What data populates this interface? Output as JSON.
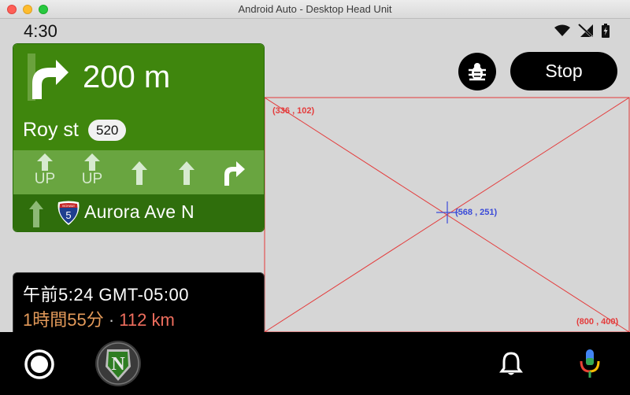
{
  "window": {
    "title": "Android Auto - Desktop Head Unit"
  },
  "status_bar": {
    "time": "4:30",
    "icons": [
      "wifi-icon",
      "no-signal-icon",
      "battery-icon"
    ]
  },
  "navigation": {
    "maneuver_icon": "turn-right-icon",
    "distance": "200 m",
    "street": "Roy st",
    "route_number": "520",
    "lanes": [
      {
        "icon": "lane-straight-icon",
        "label": "UP"
      },
      {
        "icon": "lane-straight-icon",
        "label": "UP"
      },
      {
        "icon": "lane-straight-icon",
        "label": ""
      },
      {
        "icon": "lane-straight-icon",
        "label": ""
      },
      {
        "icon": "lane-turn-right-icon",
        "label": ""
      }
    ],
    "then": {
      "icon": "straight-arrow-icon",
      "shield_label": "HIGHWAY",
      "shield_number": "5",
      "road": "Aurora Ave N"
    }
  },
  "eta": {
    "arrival": "午前5:24 GMT-05:00",
    "duration": "1時間55分",
    "separator": "·",
    "distance": "112 km"
  },
  "controls": {
    "debug_icon": "bug-icon",
    "stop_label": "Stop"
  },
  "map_debug": {
    "top_left_label": "(336 , 102)",
    "center_label": "(568 , 251)",
    "bottom_right_label": "(800 , 400)",
    "line_color": "#e43b3b",
    "center_color": "#3b4bd8"
  },
  "bottom_bar": {
    "home_icon": "home-icon",
    "app_icon": "app-n-logo-icon",
    "notification_icon": "bell-icon",
    "assistant_icon": "mic-icon"
  },
  "colors": {
    "nav_primary": "#3f860d",
    "nav_lanes": "#69a540",
    "nav_then": "#2f6e0c",
    "eta_duration": "#e39a5a",
    "eta_distance": "#ef6e5e"
  }
}
